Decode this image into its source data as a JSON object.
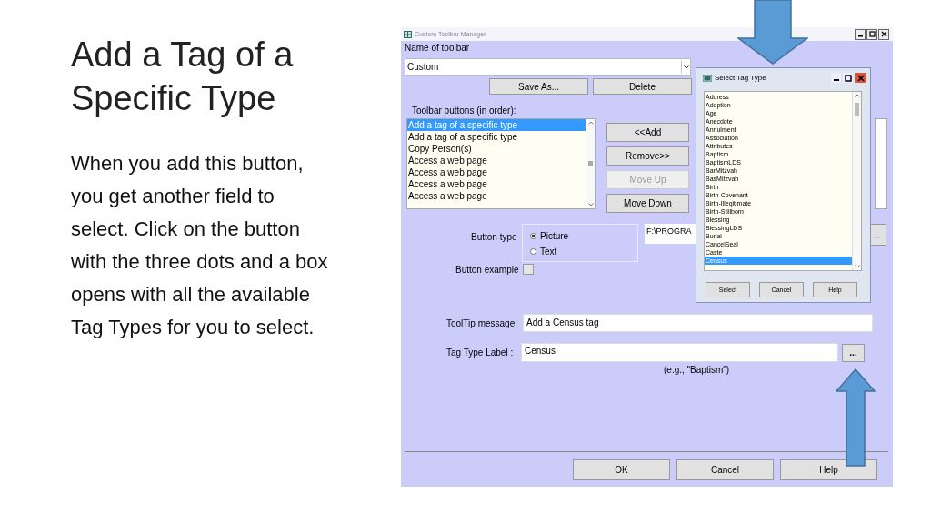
{
  "slide": {
    "title": "Add a Tag of  a Specific Type",
    "body": "When you add this button, you get another field to select. Click on the button with the three dots and a box opens with all the available Tag Types for you to select."
  },
  "window": {
    "title": "Custom Toolbar Manager",
    "name_label": "Name of  toolbar",
    "toolbar_name": "Custom",
    "save_as": "Save As...",
    "delete": "Delete",
    "list_label": "Toolbar buttons (in order):",
    "toolbar_buttons": [
      {
        "label": "Add a tag of a specific type",
        "selected": true
      },
      {
        "label": "Add a tag of a specific type",
        "selected": false
      },
      {
        "label": "Copy Person(s)",
        "selected": false
      },
      {
        "label": "Access a web page",
        "selected": false
      },
      {
        "label": "Access a web page",
        "selected": false
      },
      {
        "label": "Access a web page",
        "selected": false
      },
      {
        "label": "Access a web page",
        "selected": false
      }
    ],
    "actions": [
      {
        "label": "<<Add",
        "disabled": false
      },
      {
        "label": "Remove>>",
        "disabled": false
      },
      {
        "label": "Move Up",
        "disabled": true
      },
      {
        "label": "Move Down",
        "disabled": false
      }
    ],
    "button_type_label": "Button type",
    "button_types": [
      {
        "label": "Picture",
        "selected": true
      },
      {
        "label": "Text",
        "selected": false
      }
    ],
    "path": "F:\\PROGRA",
    "path_browse": "...",
    "example_label": "Button example",
    "example_checked": false,
    "tooltip_label": "ToolTip message:",
    "tooltip": "Add a Census tag",
    "tag_label": "Tag Type Label :",
    "tag": "Census",
    "tag_browse": "...",
    "hint": "(e.g., \"Baptism\")",
    "buttons": [
      "OK",
      "Cancel",
      "Help"
    ]
  },
  "popup": {
    "title": "Select Tag Type",
    "items": [
      {
        "label": "Address",
        "selected": false
      },
      {
        "label": "Adoption",
        "selected": false
      },
      {
        "label": "Age",
        "selected": false
      },
      {
        "label": "Anecdote",
        "selected": false
      },
      {
        "label": "Annulment",
        "selected": false
      },
      {
        "label": "Association",
        "selected": false
      },
      {
        "label": "Attributes",
        "selected": false
      },
      {
        "label": "Baptism",
        "selected": false
      },
      {
        "label": "BaptismLDS",
        "selected": false
      },
      {
        "label": "BarMitzvah",
        "selected": false
      },
      {
        "label": "BasMitzvah",
        "selected": false
      },
      {
        "label": "Birth",
        "selected": false
      },
      {
        "label": "Birth-Covenant",
        "selected": false
      },
      {
        "label": "Birth-Illegitimate",
        "selected": false
      },
      {
        "label": "Birth-Stillborn",
        "selected": false
      },
      {
        "label": "Blessing",
        "selected": false
      },
      {
        "label": "BlessingLDS",
        "selected": false
      },
      {
        "label": "Burial",
        "selected": false
      },
      {
        "label": "CancelSeal",
        "selected": false
      },
      {
        "label": "Caste",
        "selected": false
      },
      {
        "label": "Census",
        "selected": true
      }
    ],
    "buttons": [
      "Select",
      "Cancel",
      "Help"
    ]
  }
}
